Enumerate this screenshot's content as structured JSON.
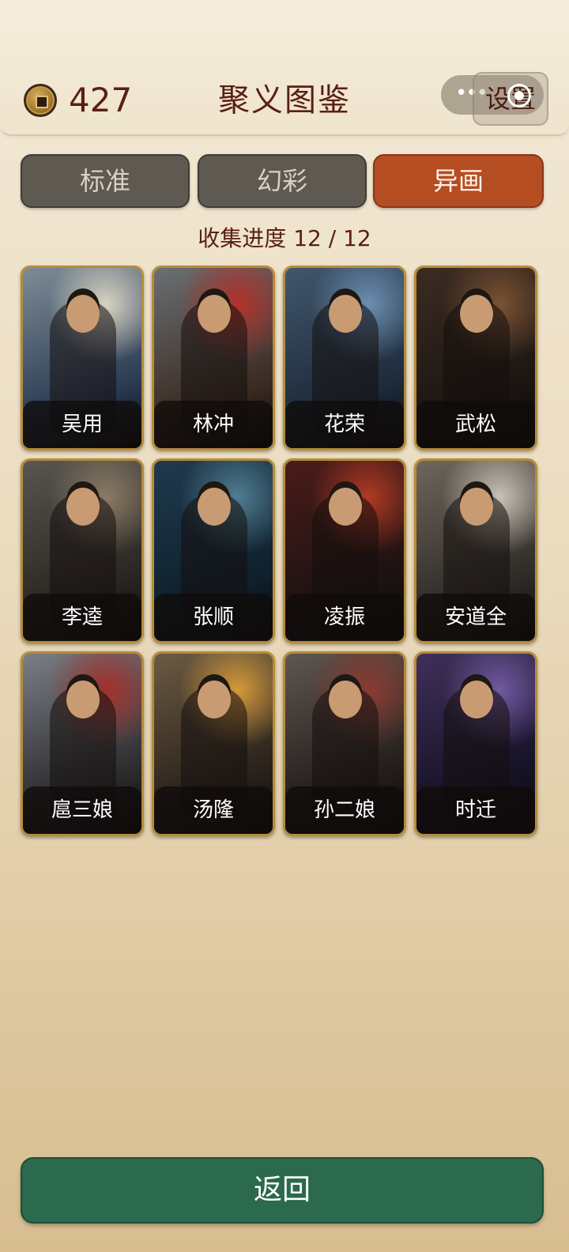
{
  "header": {
    "coins": "427",
    "title": "聚义图鉴",
    "settings_label": "设置",
    "menu_dots": "•••"
  },
  "tabs": [
    {
      "label": "标准",
      "active": false
    },
    {
      "label": "幻彩",
      "active": false
    },
    {
      "label": "异画",
      "active": true
    }
  ],
  "progress": {
    "label": "收集进度",
    "current": "12",
    "total": "12",
    "text": "收集进度  12 / 12"
  },
  "cards": [
    {
      "name": "吴用",
      "palette": [
        "#7d8c96",
        "#2a3a52",
        "#d9d2c3"
      ]
    },
    {
      "name": "林冲",
      "palette": [
        "#6b6f73",
        "#3a2b22",
        "#b3312a"
      ]
    },
    {
      "name": "花荣",
      "palette": [
        "#41566c",
        "#1d2a3a",
        "#6b8fb2"
      ]
    },
    {
      "name": "武松",
      "palette": [
        "#3b2c22",
        "#1b1511",
        "#7a5233"
      ]
    },
    {
      "name": "李逵",
      "palette": [
        "#585650",
        "#2a2521",
        "#8c7a64"
      ]
    },
    {
      "name": "张顺",
      "palette": [
        "#1f3b4e",
        "#0f1f2c",
        "#4f7d91"
      ]
    },
    {
      "name": "凌振",
      "palette": [
        "#4a1c1a",
        "#1c1212",
        "#b03a25"
      ]
    },
    {
      "name": "安道全",
      "palette": [
        "#6e665c",
        "#2e2a26",
        "#c8c2b6"
      ]
    },
    {
      "name": "扈三娘",
      "palette": [
        "#7a7f86",
        "#2c2b2e",
        "#a2312b"
      ]
    },
    {
      "name": "汤隆",
      "palette": [
        "#6b5a44",
        "#2a211a",
        "#d49a3a"
      ]
    },
    {
      "name": "孙二娘",
      "palette": [
        "#5e5650",
        "#231c1a",
        "#8b3a31"
      ]
    },
    {
      "name": "时迁",
      "palette": [
        "#3f2f5a",
        "#161226",
        "#7059a0"
      ]
    }
  ],
  "return_button": "返回"
}
